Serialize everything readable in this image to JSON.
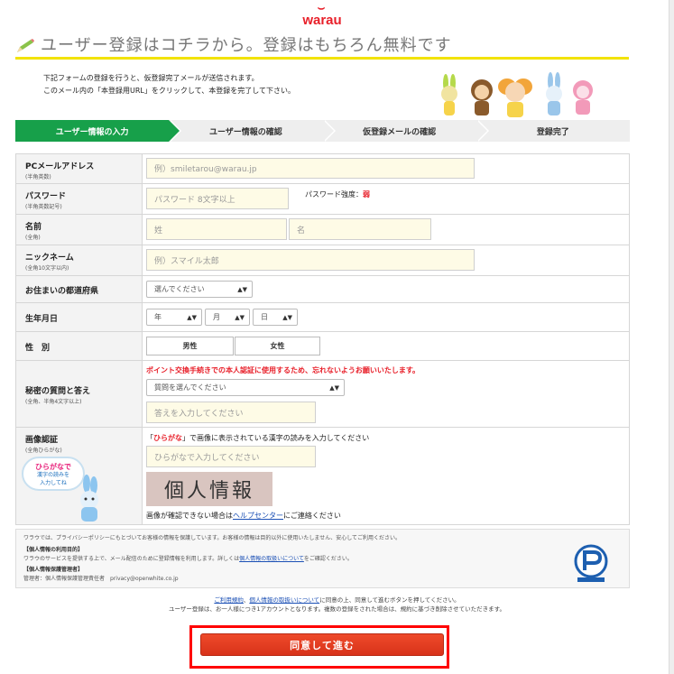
{
  "logo": {
    "mark": "⌣",
    "word": "warau"
  },
  "page_title": "ユーザー登録はコチラから。登録はもちろん無料です",
  "intro": {
    "line1": "下記フォームの登録を行うと、仮登録完了メールが送信されます。",
    "line2": "このメール内の「本登録用URL」をクリックして、本登録を完了して下さい。"
  },
  "steps": [
    {
      "label": "ユーザー情報の入力",
      "active": true
    },
    {
      "label": "ユーザー情報の確認",
      "active": false
    },
    {
      "label": "仮登録メールの確認",
      "active": false
    },
    {
      "label": "登録完了",
      "active": false
    }
  ],
  "form": {
    "email": {
      "label": "PCメールアドレス",
      "sub": "(半角英数)",
      "placeholder": "例）smiletarou@warau.jp"
    },
    "password": {
      "label": "パスワード",
      "sub": "(半角英数記号)",
      "placeholder": "パスワード 8文字以上",
      "strength_label": "パスワード強度：",
      "strength_value": "弱"
    },
    "name": {
      "label": "名前",
      "sub": "(全角)",
      "last_placeholder": "姓",
      "first_placeholder": "名"
    },
    "nickname": {
      "label": "ニックネーム",
      "sub": "(全角10文字以内)",
      "placeholder": "例）スマイル太郎"
    },
    "prefecture": {
      "label": "お住まいの都道府県",
      "value": "選んでください"
    },
    "birthday": {
      "label": "生年月日",
      "year": "年",
      "month": "月",
      "day": "日"
    },
    "gender": {
      "label": "性　別",
      "male": "男性",
      "female": "女性"
    },
    "secret": {
      "label": "秘密の質問と答え",
      "sub": "(全角、半角4文字以上)",
      "warning": "ポイント交換手続きでの本人認証に使用するため、忘れないようお願いいたします。",
      "question_value": "質問を選んでください",
      "answer_placeholder": "答えを入力してください"
    },
    "captcha": {
      "label": "画像認証",
      "sub": "(全角ひらがな)",
      "note_prefix": "「",
      "note_highlight": "ひらがな",
      "note_suffix": "」で画像に表示されている漢字の読みを入力してください",
      "placeholder": "ひらがなで入力してください",
      "image_text": "個人情報",
      "help_prefix": "画像が確認できない場合は",
      "help_link": "ヘルプセンター",
      "help_suffix": "にご連絡ください",
      "bubble_top": "ひらがなで",
      "bubble_mid": "漢字の読みを",
      "bubble_bot": "入力してね"
    }
  },
  "privacy": {
    "line1": "ワラウでは、プライバシーポリシーにもとづいてお客様の情報を保護しています。お客様の情報は目的以外に使用いたしません、安心してご利用ください。",
    "purpose_title": "【個人情報の利用目的】",
    "purpose_text": "ワラウのサービスを提供する上で、メール配信のために登録情報を利用します。詳しくは",
    "purpose_link": "個人情報の取扱いについて",
    "purpose_end": "をご確認ください。",
    "manager_title": "【個人情報保護管理者】",
    "manager_text": "管理者：個人情報保護管理責任者　privacy@openwhite.co.jp"
  },
  "agree": {
    "link1": "ご利用規約",
    "sep": "、",
    "link2": "個人情報の取扱いについて",
    "line1_end": "に同意の上、同意して進むボタンを押してください。",
    "line2": "ユーザー登録は、お一人様につき1アカウントとなります。複数の登録をされた場合は、規約に基づき削除させていただきます。"
  },
  "submit_label": "同意して進む",
  "colors": {
    "brand_red": "#e8202a",
    "step_green": "#17a04a",
    "title_underline": "#f2e300",
    "field_bg": "#fefbe6"
  }
}
